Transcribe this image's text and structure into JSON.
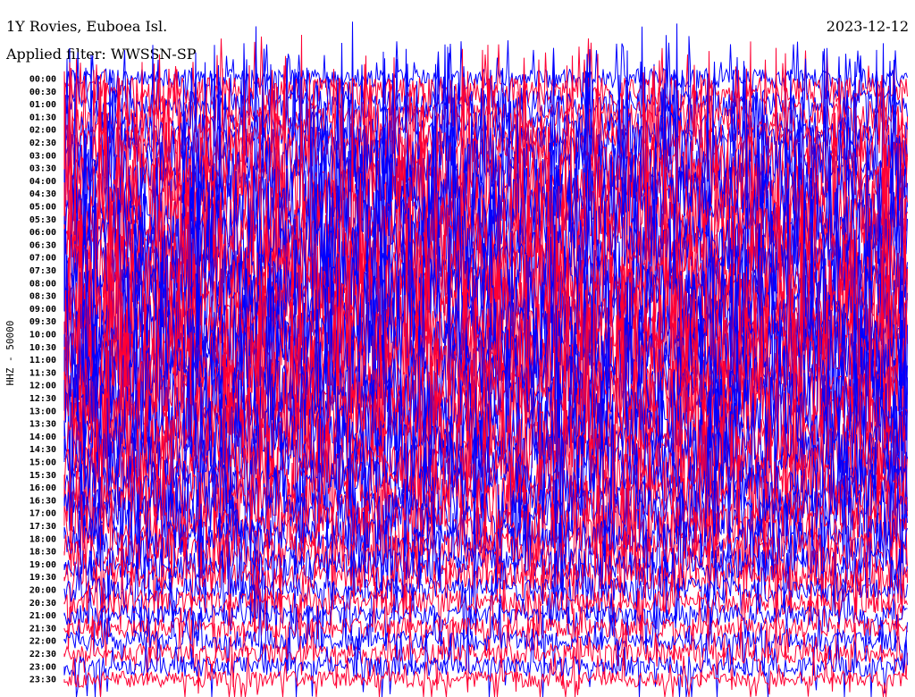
{
  "header": {
    "station": "1Y Rovies, Euboea Isl.",
    "filter": "Applied filter: WWSSN-SP",
    "date": "2023-12-12"
  },
  "colors": {
    "trace_a": "#0000ff",
    "trace_b": "#ff0033",
    "background": "#ffffff",
    "text": "#000000"
  },
  "chart_data": {
    "type": "line",
    "ylabel": "HHZ - 50000",
    "xlabel": "",
    "title": "",
    "grid": false,
    "legend": "none",
    "trace_colors_alternate": [
      "#0000ff",
      "#ff0033"
    ],
    "rows": [
      "00:00",
      "00:30",
      "01:00",
      "01:30",
      "02:00",
      "02:30",
      "03:00",
      "03:30",
      "04:00",
      "04:30",
      "05:00",
      "05:30",
      "06:00",
      "06:30",
      "07:00",
      "07:30",
      "08:00",
      "08:30",
      "09:00",
      "09:30",
      "10:00",
      "10:30",
      "11:00",
      "11:30",
      "12:00",
      "12:30",
      "13:00",
      "13:30",
      "14:00",
      "14:30",
      "15:00",
      "15:30",
      "16:00",
      "16:30",
      "17:00",
      "17:30",
      "18:00",
      "18:30",
      "19:00",
      "19:30",
      "20:00",
      "20:30",
      "21:00",
      "21:30",
      "22:00",
      "22:30",
      "23:00",
      "23:30"
    ],
    "relative_amplitude": [
      0.25,
      0.35,
      0.35,
      0.4,
      0.45,
      0.5,
      0.7,
      0.85,
      1.0,
      1.0,
      1.0,
      1.0,
      1.0,
      1.0,
      1.0,
      1.0,
      1.0,
      1.0,
      1.0,
      1.0,
      1.0,
      1.0,
      1.0,
      1.0,
      1.0,
      1.0,
      1.0,
      0.95,
      0.9,
      0.85,
      0.8,
      0.75,
      0.7,
      0.65,
      0.6,
      0.55,
      0.5,
      0.45,
      0.4,
      0.35,
      0.3,
      0.3,
      0.25,
      0.25,
      0.25,
      0.25,
      0.25,
      0.2
    ]
  }
}
